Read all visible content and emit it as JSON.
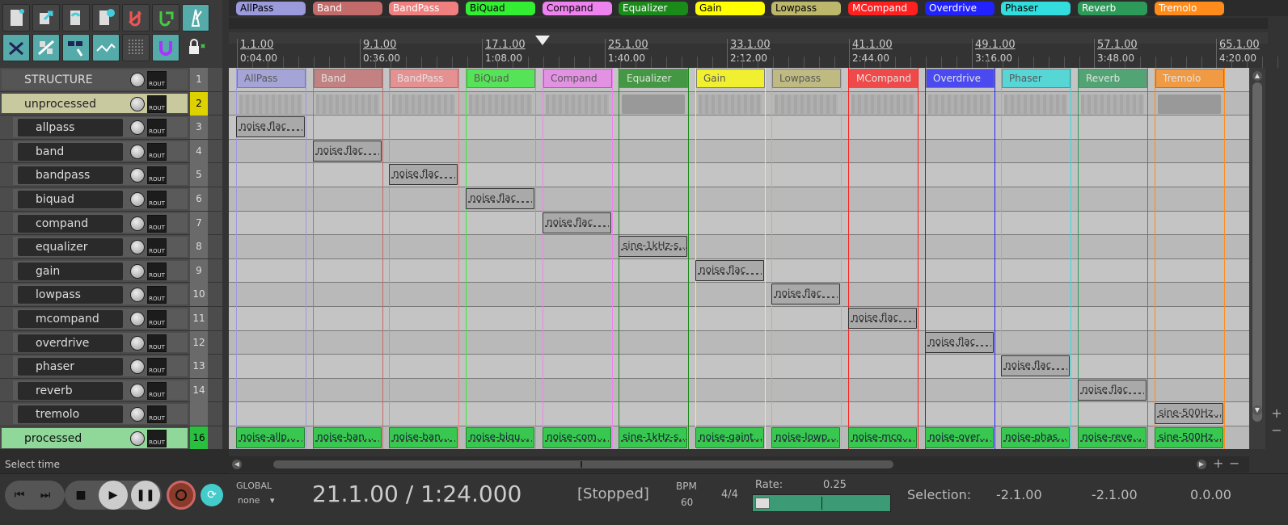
{
  "colors": {
    "allpass": "#9a9adc",
    "band": "#c36b6b",
    "bandpass": "#f08080",
    "biquad": "#33ee33",
    "compand": "#ee82ee",
    "equalizer": "#1a8a1a",
    "gain": "#ffff00",
    "lowpass": "#bdb76b",
    "mcompand": "#ff2020",
    "overdrive": "#2222ff",
    "phaser": "#33dddd",
    "reverb": "#2e9a5a",
    "tremolo": "#ff8c1a"
  },
  "regions": [
    "AllPass",
    "Band",
    "BandPass",
    "BiQuad",
    "Compand",
    "Equalizer",
    "Gain",
    "Lowpass",
    "MCompand",
    "Overdrive",
    "Phaser",
    "Reverb",
    "Tremolo"
  ],
  "ruler": {
    "bars": [
      "1.1.00",
      "9.1.00",
      "17.1.00",
      "25.1.00",
      "33.1.00",
      "41.1.00",
      "49.1.00",
      "57.1.00",
      "65.1.00"
    ],
    "times": [
      "0:04.00",
      "0:36.00",
      "1:08.00",
      "1:40.00",
      "2:12.00",
      "2:44.00",
      "3:16.00",
      "3:48.00",
      "4:20.00"
    ]
  },
  "tracks": [
    {
      "name": "STRUCTURE",
      "num": "1"
    },
    {
      "name": "unprocessed",
      "num": "2"
    },
    {
      "name": "allpass",
      "num": "3"
    },
    {
      "name": "band",
      "num": "4"
    },
    {
      "name": "bandpass",
      "num": "5"
    },
    {
      "name": "biquad",
      "num": "6"
    },
    {
      "name": "compand",
      "num": "7"
    },
    {
      "name": "equalizer",
      "num": "8"
    },
    {
      "name": "gain",
      "num": "9"
    },
    {
      "name": "lowpass",
      "num": "10"
    },
    {
      "name": "mcompand",
      "num": "11"
    },
    {
      "name": "overdrive",
      "num": "12"
    },
    {
      "name": "phaser",
      "num": "13"
    },
    {
      "name": "reverb",
      "num": "14"
    },
    {
      "name": "tremolo",
      "num": ""
    },
    {
      "name": "processed",
      "num": "16"
    }
  ],
  "rout_label": "ROUT",
  "structure_items": [
    "AllPass",
    "Band",
    "BandPass",
    "BiQuad",
    "Compand",
    "Equalizer",
    "Gain",
    "Lowpass",
    "MCompand",
    "Overdrive",
    "Phaser",
    "Reverb",
    "Tremolo"
  ],
  "source_items": [
    "noise.flac",
    "noise.flac",
    "noise.flac",
    "noise.flac",
    "noise.flac",
    "sine-1kHz-s...",
    "noise.flac",
    "noise.flac",
    "noise.flac",
    "noise.flac",
    "noise.flac",
    "noise.flac",
    "sine-500Hz..."
  ],
  "processed_items": [
    "noise-allp...",
    "noise-ban...",
    "noise-ban...",
    "noise-biqu...",
    "noise-com...",
    "sine-1kHz-s...",
    "noise-gaint...",
    "noise-lowp...",
    "noise-mco...",
    "noise-over...",
    "noise-phas...",
    "noise-reve...",
    "sine-500Hz..."
  ],
  "status_text": "Select time",
  "transport": {
    "global_label": "GLOBAL",
    "global_value": "none",
    "position": "21.1.00 / 1:24.000",
    "state": "[Stopped]",
    "bpm_label": "BPM",
    "bpm_value": "60",
    "time_sig": "4/4",
    "rate_label": "Rate:",
    "rate_value": "0.25",
    "selection_label": "Selection:",
    "sel_start": "-2.1.00",
    "sel_end": "-2.1.00",
    "sel_length": "0.0.00"
  }
}
